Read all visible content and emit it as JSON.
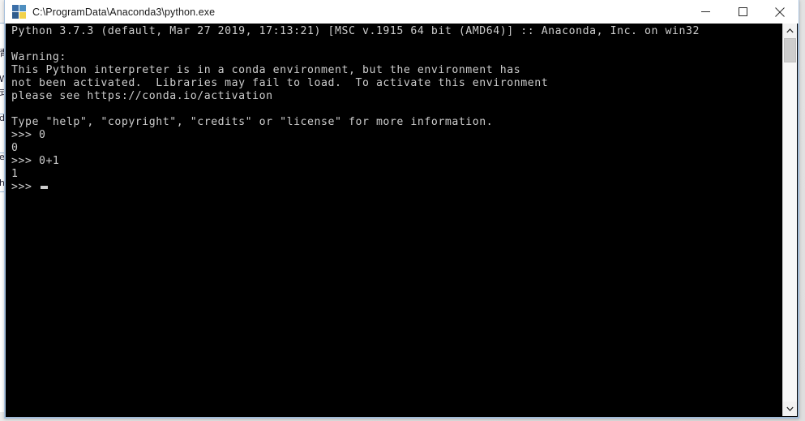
{
  "window": {
    "title": "C:\\ProgramData\\Anaconda3\\python.exe",
    "icon": "python-icon",
    "controls": {
      "minimize_label": "Minimize",
      "maximize_label": "Maximize",
      "close_label": "Close"
    }
  },
  "console": {
    "background_color": "#000000",
    "text_color": "#cccccc",
    "lines": [
      "Python 3.7.3 (default, Mar 27 2019, 17:13:21) [MSC v.1915 64 bit (AMD64)] :: Anaconda, Inc. on win32",
      "",
      "Warning:",
      "This Python interpreter is in a conda environment, but the environment has",
      "not been activated.  Libraries may fail to load.  To activate this environment",
      "please see https://conda.io/activation",
      "",
      "Type \"help\", \"copyright\", \"credits\" or \"license\" for more information.",
      ">>> 0",
      "0",
      ">>> 0+1",
      "1"
    ],
    "prompt": ">>> ",
    "cursor": "block-cursor"
  },
  "scrollbar": {
    "up_arrow": "chevron-up-icon",
    "down_arrow": "chevron-down-icon",
    "thumb_position_percent": 0,
    "thumb_size_percent": 6
  },
  "background_window_sliver": {
    "glyphs": [
      "",
      "青",
      "",
      "W",
      "式",
      "",
      "d",
      "",
      "",
      "e",
      "",
      "h",
      ""
    ]
  }
}
